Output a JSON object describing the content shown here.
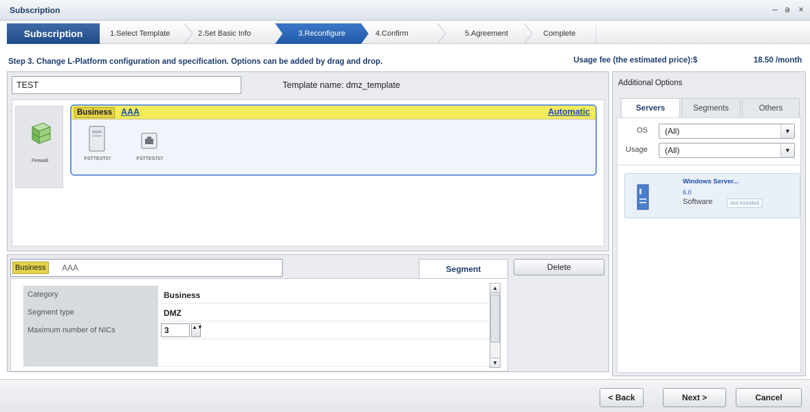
{
  "window": {
    "title": "Subscription"
  },
  "wizard": {
    "home": "Subscription",
    "steps": [
      "1.Select Template",
      "2.Set Basic Info",
      "3.Reconfigure",
      "4.Confirm",
      "5.Agreement",
      "Complete"
    ]
  },
  "instruction": "Step 3. Change L-Platform configuration and specification. Options can be added by drag and drop.",
  "usage_fee": {
    "label": "Usage fee (the estimated price):$",
    "value": "18.50 /month"
  },
  "platform": {
    "name": "TEST",
    "template_label": "Template name: dmz_template"
  },
  "canvas": {
    "firewall_label": "Firewall",
    "segment": {
      "badge": "Business",
      "name": "AAA",
      "auto_label": "Automatic"
    },
    "servers": [
      "FSTTEST07",
      "FSTTEST07"
    ]
  },
  "detail": {
    "badge": "Business",
    "value": "AAA",
    "tab": "Segment",
    "delete_label": "Delete",
    "rows": [
      {
        "key": "Category",
        "value": "Business"
      },
      {
        "key": "Segment type",
        "value": "DMZ"
      },
      {
        "key": "Maximum number of NICs",
        "value": "3"
      }
    ]
  },
  "options": {
    "title": "Additional Options",
    "tabs": [
      "Servers",
      "Segments",
      "Others"
    ],
    "active_tab": "Servers",
    "filters": [
      {
        "label": "OS",
        "value": "(All)"
      },
      {
        "label": "Usage",
        "value": "(All)"
      }
    ],
    "item": {
      "name": "Windows Server...",
      "version": "6.0",
      "type": "Software",
      "badge": "Not included"
    }
  },
  "footer": {
    "back": "< Back",
    "next": "Next >",
    "cancel": "Cancel"
  },
  "icons": {
    "minimize": "–",
    "restore": "ə",
    "close": "×",
    "dropdown": "▼",
    "spin": "▲▼",
    "scroll_up": "▲",
    "scroll_down": "▼"
  },
  "colors": {
    "accent": "#1f5aa8",
    "segment_header": "#f2ec5a",
    "link": "#1f4fa8"
  }
}
